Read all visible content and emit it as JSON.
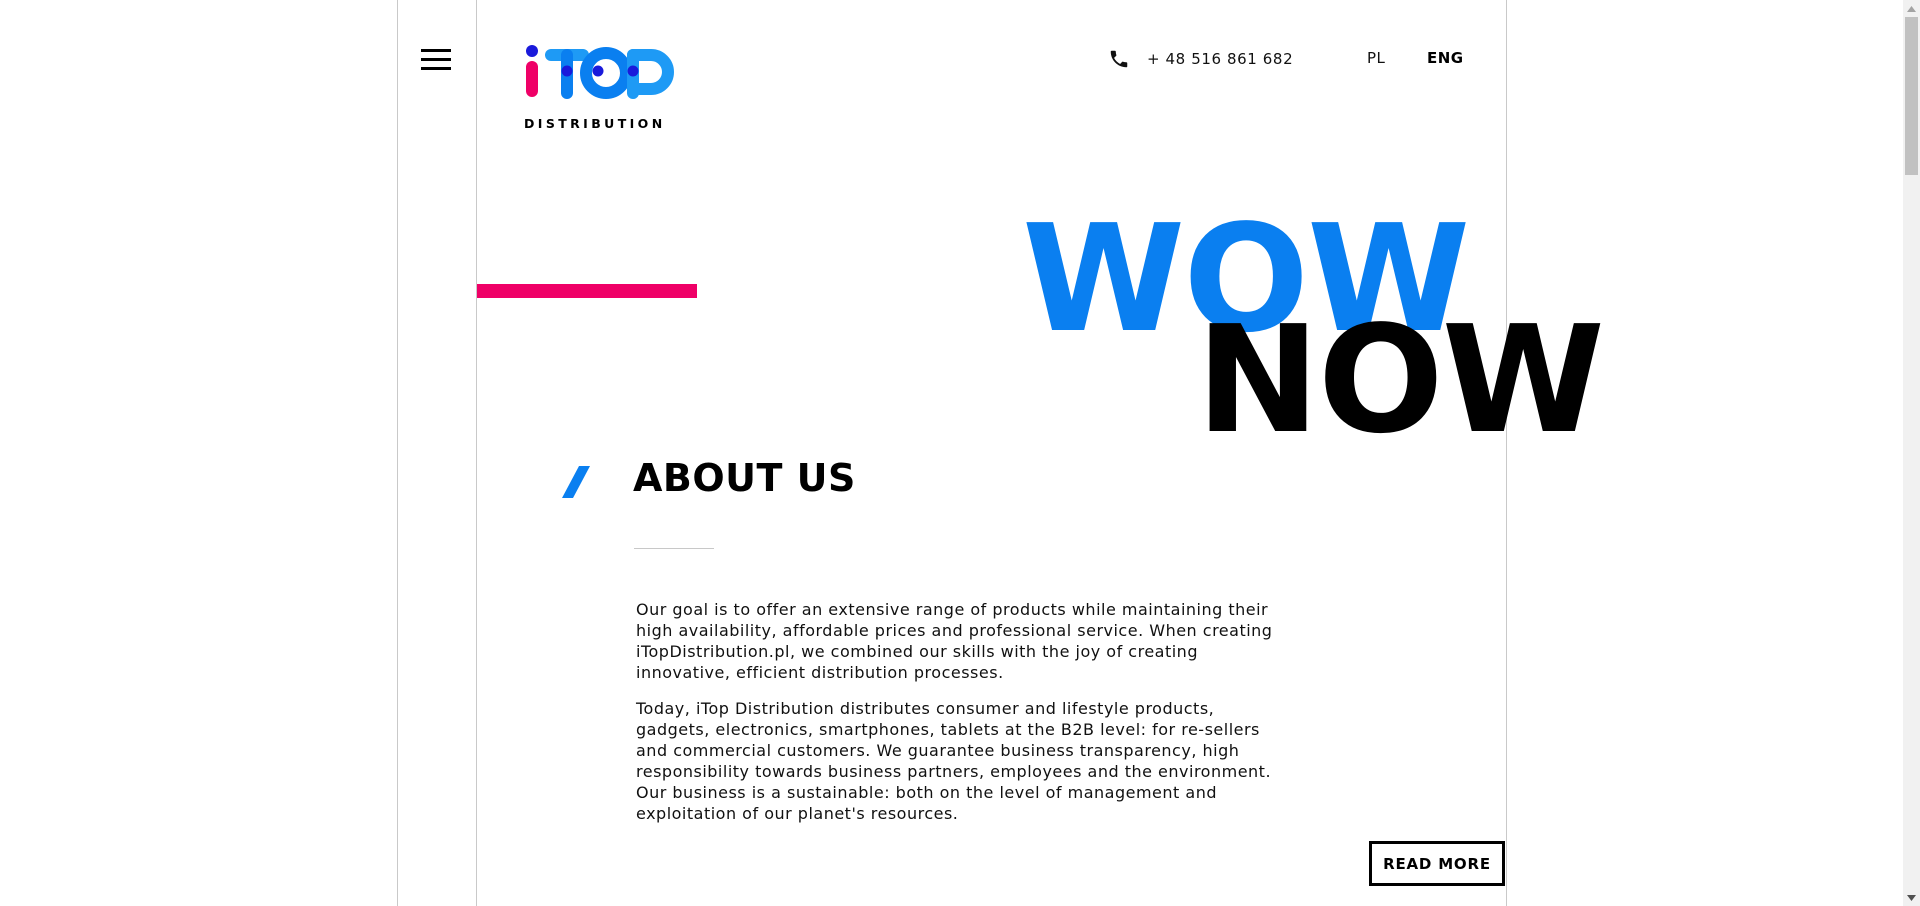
{
  "header": {
    "logo": {
      "wordmark": "iTOP",
      "subtitle": "DISTRIBUTION",
      "colors": {
        "i_stem": "#ef0067",
        "i_dot": "#1a1adb",
        "letters": "#0a7ff0",
        "letters_light": "#1e9af5",
        "dots": "#1a1adb"
      }
    },
    "menu_icon": "hamburger-icon",
    "phone": {
      "icon": "phone-icon",
      "number": "+ 48 516 861 682"
    },
    "languages": [
      {
        "label": "PL",
        "active": false
      },
      {
        "label": "ENG",
        "active": true
      }
    ]
  },
  "hero": {
    "word_top": "WOW",
    "word_bottom": "NOW",
    "accent_bar_color": "#ef0067",
    "word_top_color": "#0a7ff0",
    "word_bottom_color": "#000000"
  },
  "about": {
    "title": "ABOUT US",
    "slash_color": "#0a7ff0",
    "paragraphs": [
      "Our goal is to offer an extensive range of products while maintaining their high availability, affordable prices and professional service. When creating iTopDistribution.pl, we combined our skills with the joy of creating innovative, efficient distribution processes.",
      "Today, iTop Distribution distributes consumer and lifestyle products, gadgets, electronics, smartphones, tablets at the B2B level: for re-sellers and commercial customers. We guarantee business transparency, high responsibility towards business partners, employees and the environment. Our business is a sustainable: both on the level of management and exploitation of our planet's resources."
    ],
    "read_more_label": "READ MORE"
  }
}
